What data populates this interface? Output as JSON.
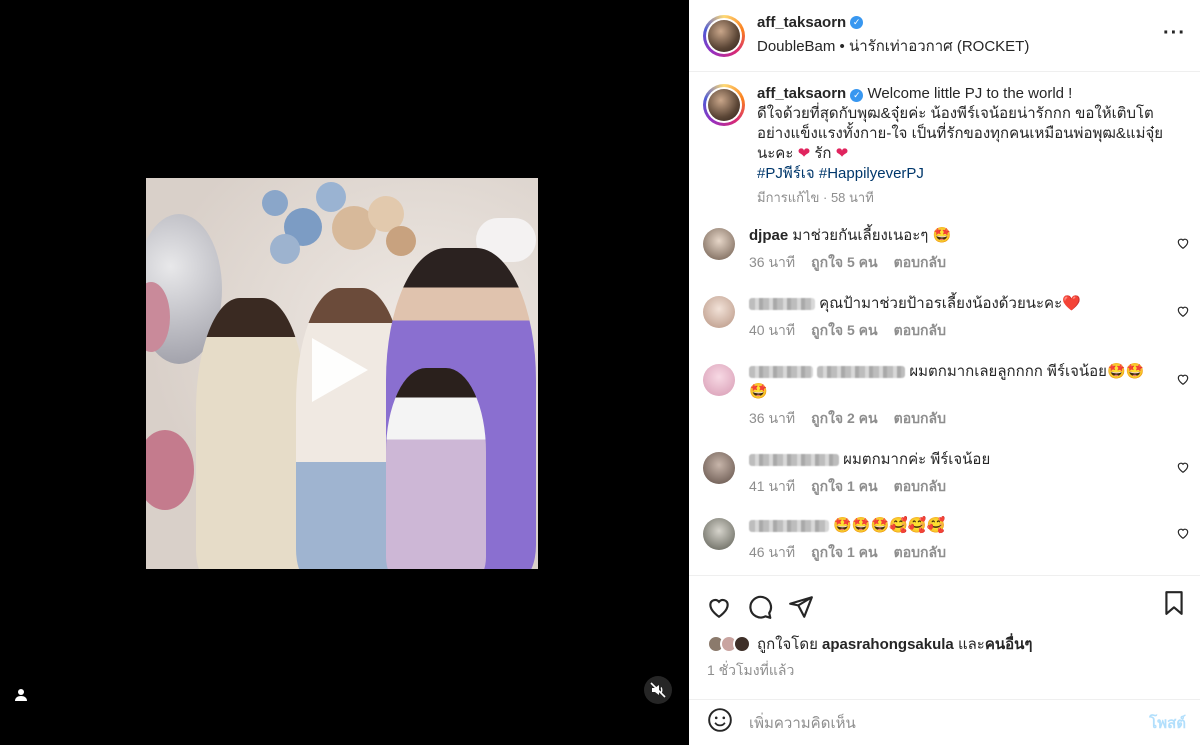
{
  "post": {
    "username": "aff_taksaorn",
    "location_line": "DoubleBam • น่ารักเท่าอวกาศ (ROCKET)"
  },
  "caption": {
    "username": "aff_taksaorn",
    "line1": "Welcome little PJ to the world !",
    "line2": "ดีใจด้วยที่สุดกับพุฒ&จุ๋ยค่ะ น้องพีร์เจน้อยน่ารักกก ขอให้เติบโตอย่างแข็งแรงทั้งกาย-ใจ เป็นที่รักของทุกคนเหมือนพ่อพุฒ&แม่จุ๋ยนะคะ",
    "love_word": "รัก",
    "hashtags": "#PJพีร์เจ #HappilyeverPJ",
    "meta": "มีการแก้ไข · 58 นาที"
  },
  "comments": [
    {
      "username": "djpae",
      "text": "มาช่วยกันเลี้ยงเนอะๆ 🤩",
      "time": "36 นาที",
      "likes": "ถูกใจ 5 คน",
      "reply": "ตอบกลับ"
    },
    {
      "username": "",
      "text": "คุณป้ามาช่วยป้าอรเลี้ยงน้องด้วยนะคะ❤️",
      "time": "40 นาที",
      "likes": "ถูกใจ 5 คน",
      "reply": "ตอบกลับ"
    },
    {
      "username": "",
      "text": "ผมตกมากเลยลูกกกก พีร์เจน้อย🤩🤩🤩",
      "time": "36 นาที",
      "likes": "ถูกใจ 2 คน",
      "reply": "ตอบกลับ"
    },
    {
      "username": "",
      "text": "ผมตกมากค่ะ พีร์เจน้อย",
      "time": "41 นาที",
      "likes": "ถูกใจ 1 คน",
      "reply": "ตอบกลับ"
    },
    {
      "username": "",
      "text": "🤩🤩🤩🥰🥰🥰",
      "time": "46 นาที",
      "likes": "ถูกใจ 1 คน",
      "reply": "ตอบกลับ"
    }
  ],
  "likes": {
    "prefix": "ถูกใจโดย",
    "user": "apasrahongsakula",
    "joiner": "และ",
    "others": "คนอื่นๆ"
  },
  "time_ago": "1 ชั่วโมงที่แล้ว",
  "add_comment": {
    "placeholder": "เพิ่มความคิดเห็น",
    "post_label": "โพสต์"
  },
  "icons": {
    "more": "more-horizontal-icon",
    "like": "heart-icon",
    "comment": "comment-icon",
    "share": "send-icon",
    "save": "bookmark-icon",
    "emoji": "emoji-icon",
    "mute": "mute-icon",
    "tag": "user-tag-icon",
    "play": "play-icon"
  },
  "colors": {
    "verified": "#3897f0",
    "hashtag": "#00376b",
    "gray_text": "#8e8e8e",
    "post_button": "#b2dffc",
    "red_heart": "#e0245e"
  }
}
